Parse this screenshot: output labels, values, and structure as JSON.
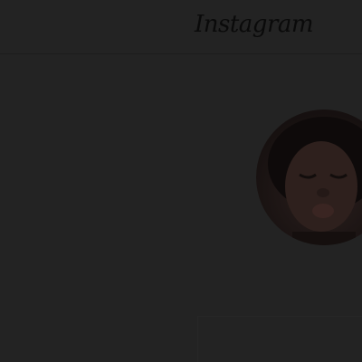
{
  "header": {
    "logo_text": "Instagram"
  },
  "profile": {
    "avatar_icon": "profile-photo"
  },
  "colors": {
    "background": "#232323",
    "logo": "#0a0a0a"
  }
}
